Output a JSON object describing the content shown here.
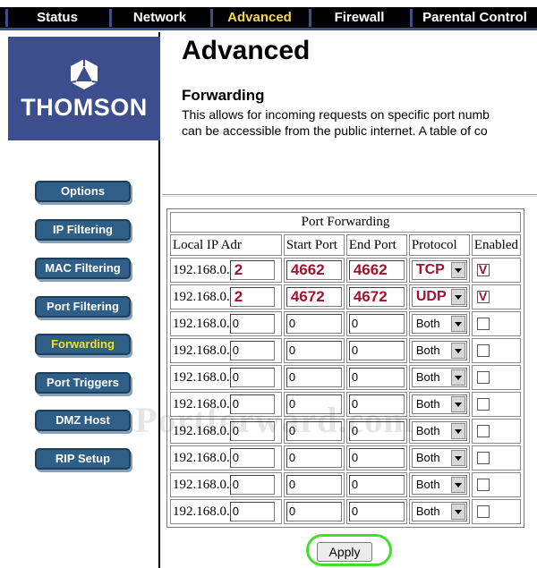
{
  "nav": {
    "tabs": [
      {
        "label": "Status"
      },
      {
        "label": "Network"
      },
      {
        "label": "Advanced"
      },
      {
        "label": "Firewall"
      },
      {
        "label": "Parental Control"
      }
    ],
    "active_tab": "Advanced"
  },
  "sidebar": {
    "logo_text": "THOMSON",
    "items": [
      {
        "label": "Options"
      },
      {
        "label": "IP Filtering"
      },
      {
        "label": "MAC Filtering"
      },
      {
        "label": "Port Filtering"
      },
      {
        "label": "Forwarding"
      },
      {
        "label": "Port Triggers"
      },
      {
        "label": "DMZ Host"
      },
      {
        "label": "RIP Setup"
      }
    ],
    "active_item": "Forwarding"
  },
  "main": {
    "title": "Advanced",
    "section_title": "Forwarding",
    "description_line1": "This allows for incoming requests on specific port numb",
    "description_line2": "can be accessible from the public internet.  A table of co"
  },
  "table": {
    "caption": "Port Forwarding",
    "headers": [
      "Local IP Adr",
      "Start Port",
      "End Port",
      "Protocol",
      "Enabled"
    ],
    "rows": [
      {
        "ip_prefix": "192.168.0.",
        "ip_last": "2",
        "start": "4662",
        "end": "4662",
        "protocol": "TCP",
        "enabled": true,
        "highlight": true
      },
      {
        "ip_prefix": "192.168.0.",
        "ip_last": "2",
        "start": "4672",
        "end": "4672",
        "protocol": "UDP",
        "enabled": true,
        "highlight": true
      },
      {
        "ip_prefix": "192.168.0.",
        "ip_last": "0",
        "start": "0",
        "end": "0",
        "protocol": "Both",
        "enabled": false,
        "highlight": false
      },
      {
        "ip_prefix": "192.168.0.",
        "ip_last": "0",
        "start": "0",
        "end": "0",
        "protocol": "Both",
        "enabled": false,
        "highlight": false
      },
      {
        "ip_prefix": "192.168.0.",
        "ip_last": "0",
        "start": "0",
        "end": "0",
        "protocol": "Both",
        "enabled": false,
        "highlight": false
      },
      {
        "ip_prefix": "192.168.0.",
        "ip_last": "0",
        "start": "0",
        "end": "0",
        "protocol": "Both",
        "enabled": false,
        "highlight": false
      },
      {
        "ip_prefix": "192.168.0.",
        "ip_last": "0",
        "start": "0",
        "end": "0",
        "protocol": "Both",
        "enabled": false,
        "highlight": false
      },
      {
        "ip_prefix": "192.168.0.",
        "ip_last": "0",
        "start": "0",
        "end": "0",
        "protocol": "Both",
        "enabled": false,
        "highlight": false
      },
      {
        "ip_prefix": "192.168.0.",
        "ip_last": "0",
        "start": "0",
        "end": "0",
        "protocol": "Both",
        "enabled": false,
        "highlight": false
      },
      {
        "ip_prefix": "192.168.0.",
        "ip_last": "0",
        "start": "0",
        "end": "0",
        "protocol": "Both",
        "enabled": false,
        "highlight": false
      }
    ]
  },
  "apply_label": "Apply",
  "watermark": "Portforward.com",
  "colors": {
    "nav_bg": "#000000",
    "nav_accent": "#3f4f8c",
    "active_text": "#f5d94a",
    "sidebar_logo_bg": "#3d4e8e",
    "button_bg": "#2f5f86",
    "annotation_red": "#a0122e",
    "highlight_ring": "#3fe02a"
  },
  "icons": {
    "logo": "thomson-logo-icon",
    "dropdown": "chevron-down-icon",
    "checkbox": "checkbox-icon"
  }
}
